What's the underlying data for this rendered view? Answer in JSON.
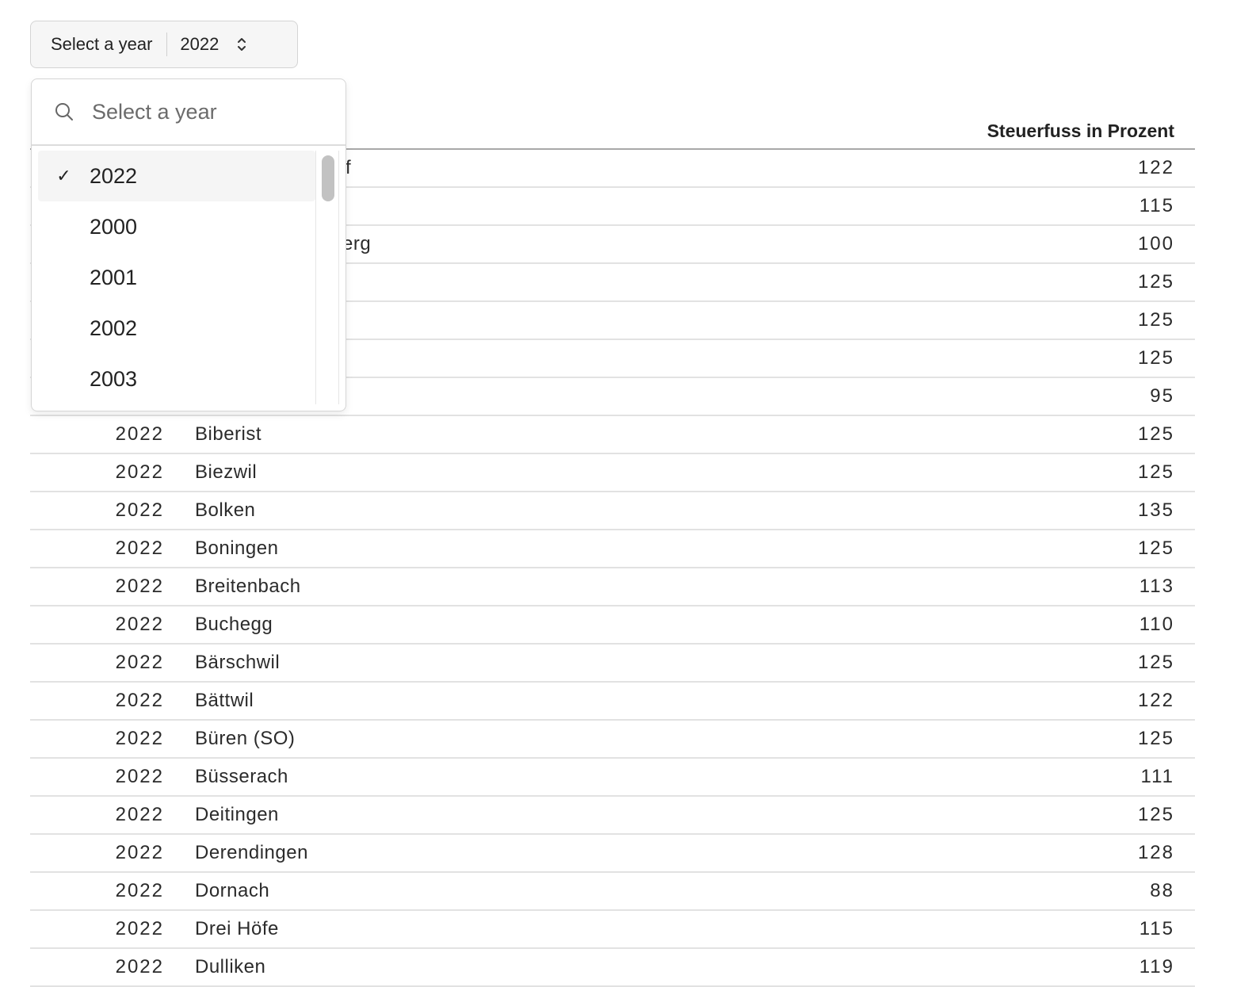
{
  "year_select": {
    "label": "Select a year",
    "value": "2022"
  },
  "dropdown": {
    "search_placeholder": "Select a year",
    "options": [
      {
        "label": "2022",
        "selected": true
      },
      {
        "label": "2000",
        "selected": false
      },
      {
        "label": "2001",
        "selected": false
      },
      {
        "label": "2002",
        "selected": false
      },
      {
        "label": "2003",
        "selected": false
      }
    ]
  },
  "table": {
    "header_value": "Steuerfuss in Prozent",
    "rows": [
      {
        "year": "",
        "name": "f",
        "value": "122"
      },
      {
        "year": "",
        "name": "",
        "value": "115"
      },
      {
        "year": "",
        "name": "erg",
        "value": "100"
      },
      {
        "year": "",
        "name": "",
        "value": "125"
      },
      {
        "year": "",
        "name": "",
        "value": "125"
      },
      {
        "year": "",
        "name": "",
        "value": "125"
      },
      {
        "year": "",
        "name": "",
        "value": "95"
      },
      {
        "year": "2022",
        "name": "Biberist",
        "value": "125"
      },
      {
        "year": "2022",
        "name": "Biezwil",
        "value": "125"
      },
      {
        "year": "2022",
        "name": "Bolken",
        "value": "135"
      },
      {
        "year": "2022",
        "name": "Boningen",
        "value": "125"
      },
      {
        "year": "2022",
        "name": "Breitenbach",
        "value": "113"
      },
      {
        "year": "2022",
        "name": "Buchegg",
        "value": "110"
      },
      {
        "year": "2022",
        "name": "Bärschwil",
        "value": "125"
      },
      {
        "year": "2022",
        "name": "Bättwil",
        "value": "122"
      },
      {
        "year": "2022",
        "name": "Büren (SO)",
        "value": "125"
      },
      {
        "year": "2022",
        "name": "Büsserach",
        "value": "111"
      },
      {
        "year": "2022",
        "name": "Deitingen",
        "value": "125"
      },
      {
        "year": "2022",
        "name": "Derendingen",
        "value": "128"
      },
      {
        "year": "2022",
        "name": "Dornach",
        "value": "88"
      },
      {
        "year": "2022",
        "name": "Drei Höfe",
        "value": "115"
      },
      {
        "year": "2022",
        "name": "Dulliken",
        "value": "119"
      }
    ]
  }
}
